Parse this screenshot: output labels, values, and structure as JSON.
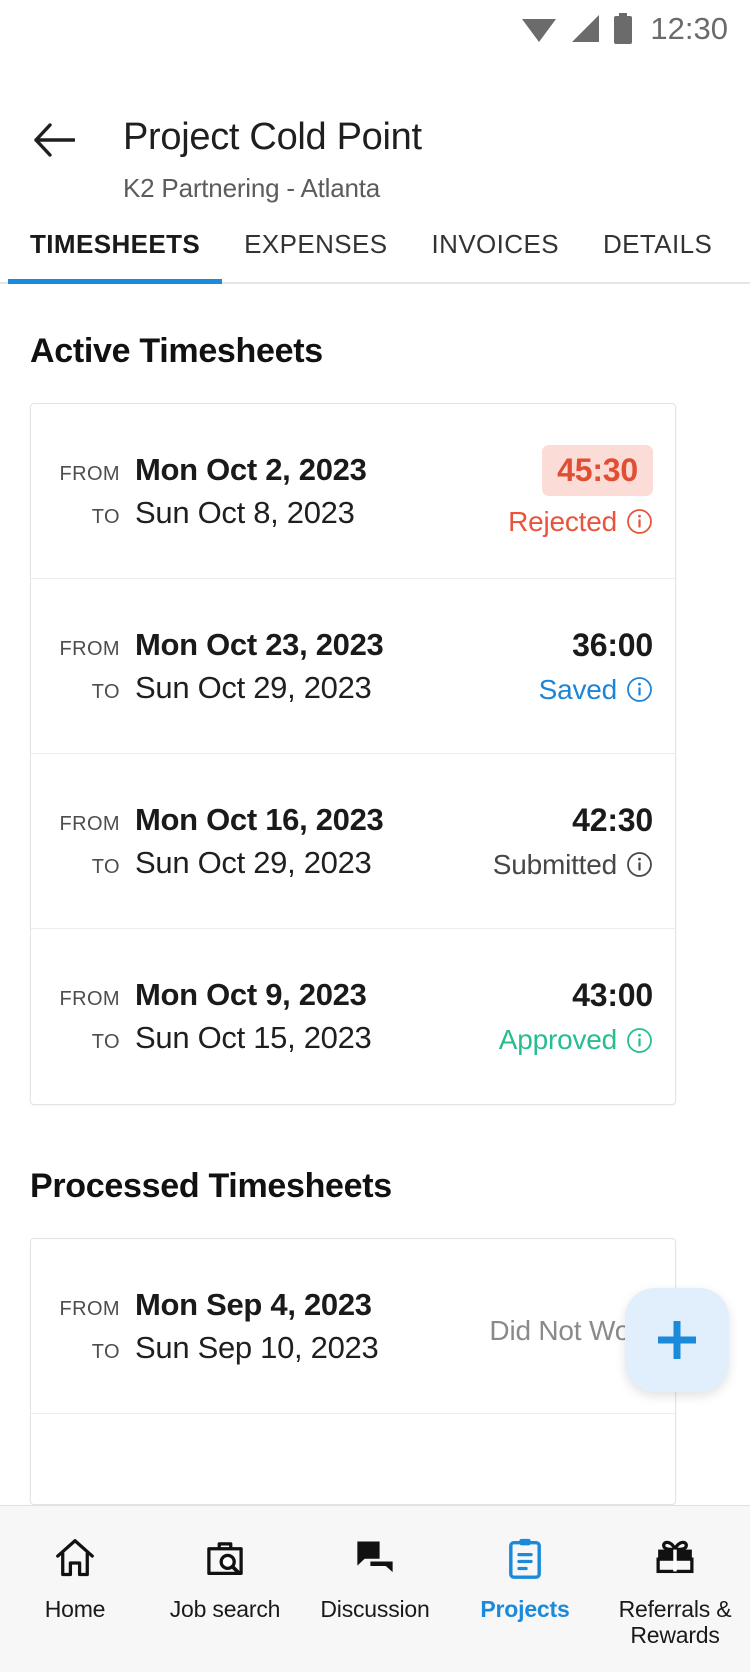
{
  "status_bar": {
    "time": "12:30",
    "icons": [
      "wifi-icon",
      "cellular-signal-icon",
      "battery-icon"
    ]
  },
  "header": {
    "back_icon": "back-arrow-icon",
    "title": "Project Cold Point",
    "subtitle": "K2 Partnering - Atlanta"
  },
  "tabs": [
    {
      "label": "TIMESHEETS",
      "active": true
    },
    {
      "label": "EXPENSES",
      "active": false
    },
    {
      "label": "INVOICES",
      "active": false
    },
    {
      "label": "DETAILS",
      "active": false
    }
  ],
  "labels": {
    "from": "FROM",
    "to": "TO"
  },
  "sections": [
    {
      "title": "Active Timesheets",
      "rows": [
        {
          "from": "Mon Oct 2, 2023",
          "to": "Sun Oct 8, 2023",
          "hours": "45:30",
          "status": "Rejected",
          "status_key": "rejected",
          "hours_badge": true
        },
        {
          "from": "Mon Oct 23, 2023",
          "to": "Sun Oct 29, 2023",
          "hours": "36:00",
          "status": "Saved",
          "status_key": "saved",
          "hours_badge": false
        },
        {
          "from": "Mon Oct 16, 2023",
          "to": "Sun Oct 29, 2023",
          "hours": "42:30",
          "status": "Submitted",
          "status_key": "submitted",
          "hours_badge": false
        },
        {
          "from": "Mon Oct 9, 2023",
          "to": "Sun Oct 15, 2023",
          "hours": "43:00",
          "status": "Approved",
          "status_key": "approved",
          "hours_badge": false
        }
      ]
    },
    {
      "title": "Processed Timesheets",
      "rows": [
        {
          "from": "Mon Sep 4, 2023",
          "to": "Sun Sep 10, 2023",
          "hours": "",
          "status": "Did Not Work",
          "status_key": "didnotwork",
          "hours_badge": false
        }
      ]
    }
  ],
  "fab": {
    "icon": "plus-icon",
    "label": "Add timesheet"
  },
  "bottom_nav": [
    {
      "label": "Home",
      "icon": "home-icon",
      "active": false
    },
    {
      "label": "Job search",
      "icon": "briefcase-search-icon",
      "active": false
    },
    {
      "label": "Discussion",
      "icon": "chat-bubbles-icon",
      "active": false
    },
    {
      "label": "Projects",
      "icon": "clipboard-icon",
      "active": true
    },
    {
      "label": "Referrals &\nRewards",
      "icon": "gift-icon",
      "active": false
    }
  ],
  "colors": {
    "accent_blue": "#1c8adb",
    "rejected_red": "#e8553c",
    "rejected_badge_bg": "#fbdcd6",
    "approved_green": "#27bd91",
    "saved_blue": "#1d85d8",
    "muted_gray": "#8a8a8a",
    "fab_bg": "#e1eefb"
  }
}
